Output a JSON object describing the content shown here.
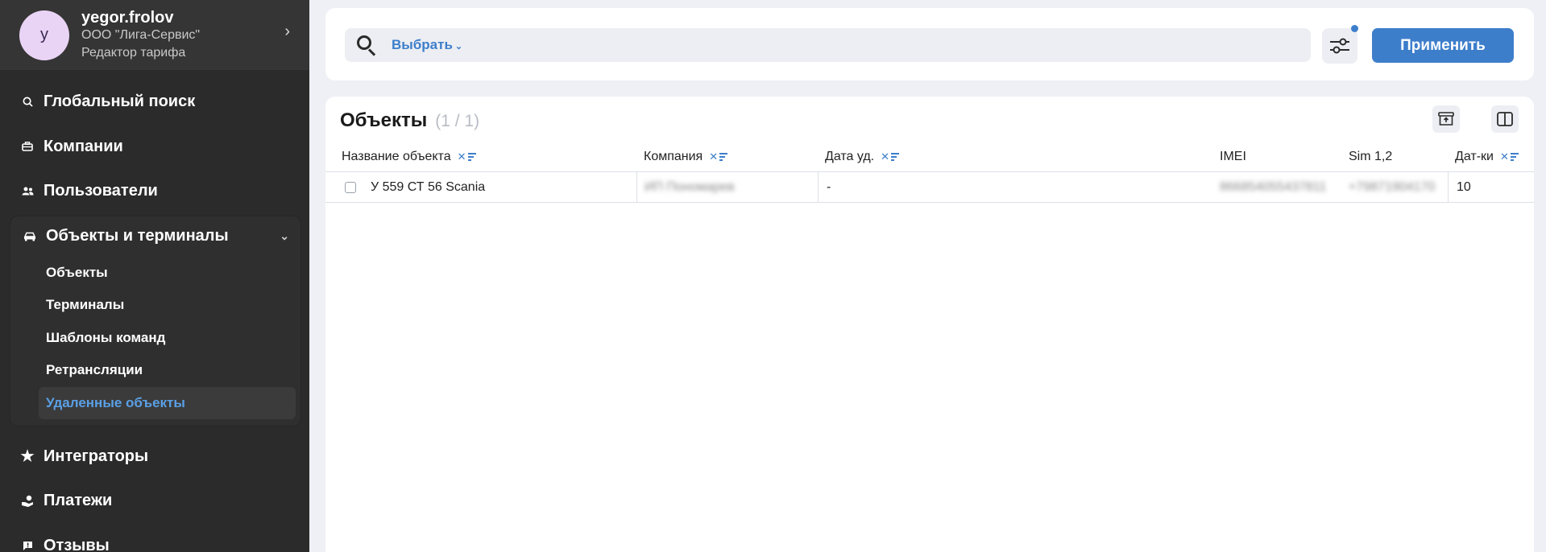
{
  "profile": {
    "avatar_letter": "y",
    "username": "yegor.frolov",
    "company": "ООО \"Лига-Сервис\"",
    "role": "Редактор тарифа"
  },
  "nav": {
    "global_search": "Глобальный поиск",
    "companies": "Компании",
    "users": "Пользователи",
    "objects_terminals": "Объекты и терминалы",
    "sub": {
      "objects": "Объекты",
      "terminals": "Терминалы",
      "command_templates": "Шаблоны команд",
      "retranslations": "Ретрансляции",
      "deleted_objects": "Удаленные объекты"
    },
    "integrators": "Интеграторы",
    "payments": "Платежи",
    "reviews": "Отзывы"
  },
  "topbar": {
    "select_label": "Выбрать",
    "apply_label": "Применить"
  },
  "panel": {
    "title": "Объекты",
    "count": "(1 / 1)"
  },
  "table": {
    "columns": {
      "name": "Название объекта",
      "company": "Компания",
      "deleted_date": "Дата уд.",
      "imei": "IMEI",
      "sim": "Sim 1,2",
      "sensors": "Дат-ки"
    },
    "rows": [
      {
        "name": "У 559 СТ 56 Scania",
        "company": "ИП Пономарев",
        "deleted_date": "-",
        "imei": "866854055437811",
        "sim": "+79871904170",
        "sensors": "10"
      }
    ]
  },
  "colors": {
    "accent": "#3d7ecb",
    "sidebar_bg": "#2b2b2b",
    "active_item": "#5aa0e6"
  }
}
